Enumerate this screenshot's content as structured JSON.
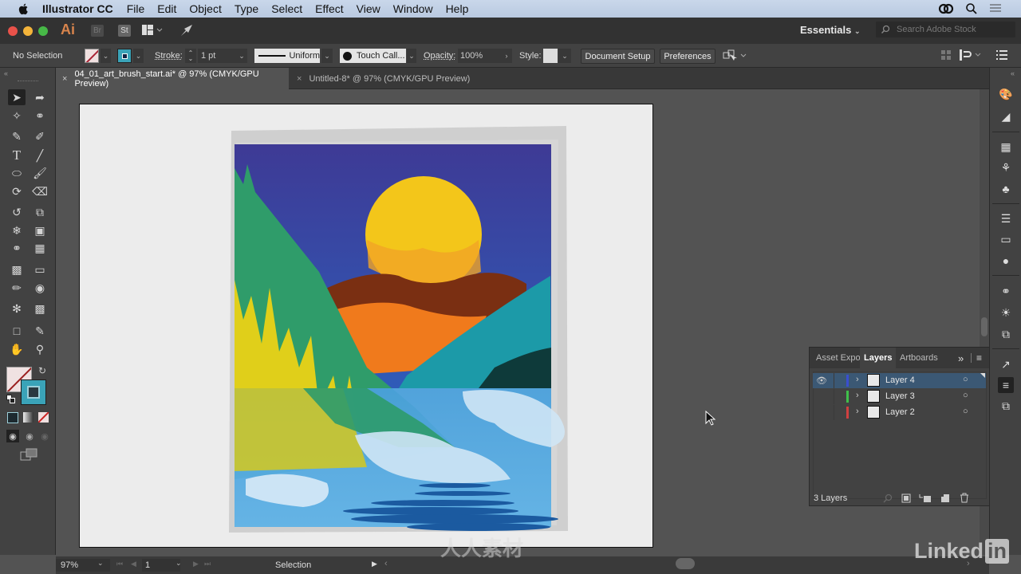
{
  "menubar": {
    "app_name": "Illustrator CC",
    "items": [
      "File",
      "Edit",
      "Object",
      "Type",
      "Select",
      "Effect",
      "View",
      "Window",
      "Help"
    ]
  },
  "appbar": {
    "logo": "Ai",
    "bridge_label": "Br",
    "stock_label": "St",
    "workspace": "Essentials",
    "search_placeholder": "Search Adobe Stock"
  },
  "control_bar": {
    "selection_status": "No Selection",
    "stroke_label": "Stroke:",
    "stroke_weight": "1 pt",
    "profile": "Uniform",
    "brush": "Touch Call...",
    "opacity_label": "Opacity:",
    "opacity": "100%",
    "style_label": "Style:",
    "document_setup": "Document Setup",
    "preferences": "Preferences"
  },
  "tabs": [
    {
      "label": "04_01_art_brush_start.ai* @ 97% (CMYK/GPU Preview)",
      "active": true
    },
    {
      "label": "Untitled-8* @ 97% (CMYK/GPU Preview)",
      "active": false
    }
  ],
  "tools": [
    "selection",
    "direct-selection",
    "magic-wand",
    "lasso",
    "pen",
    "curvature",
    "type",
    "line-segment",
    "ellipse",
    "paintbrush",
    "shaper",
    "eraser",
    "rotate",
    "scale",
    "warp",
    "free-transform",
    "shape-builder",
    "perspective-grid",
    "mesh",
    "gradient",
    "eyedropper",
    "blend",
    "symbol-sprayer",
    "column-graph",
    "artboard",
    "slice",
    "hand",
    "zoom"
  ],
  "colors": {
    "fill": "none",
    "stroke": "#3aa3b8",
    "accent_selected_row": "#3b5874",
    "layer4": "#3a4fd0",
    "layer3": "#3fc04a",
    "layer2": "#d04040"
  },
  "layers_panel": {
    "tabs": [
      "Asset Expo",
      "Layers",
      "Artboards"
    ],
    "active_tab": "Layers",
    "layers": [
      {
        "name": "Layer 4",
        "color": "#3a4fd0",
        "visible": true,
        "selected": true
      },
      {
        "name": "Layer 3",
        "color": "#3fc04a",
        "visible": false,
        "selected": false
      },
      {
        "name": "Layer 2",
        "color": "#d04040",
        "visible": false,
        "selected": false
      }
    ],
    "count_label": "3 Layers"
  },
  "status_bar": {
    "zoom": "97%",
    "artboard_number": "1",
    "tool_status": "Selection"
  },
  "watermark": {
    "brand": "LinkedIn",
    "text": "人人素材"
  }
}
